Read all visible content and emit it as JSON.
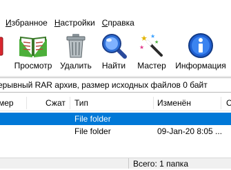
{
  "menu": {
    "favorites": "Избранное",
    "favorites_hotkey": "И",
    "settings": "Настройки",
    "settings_hotkey": "Н",
    "help": "Справка",
    "help_hotkey": "С"
  },
  "toolbar": {
    "view": "Просмотр",
    "delete": "Удалить",
    "find": "Найти",
    "wizard": "Мастер",
    "info": "Информация"
  },
  "infobar": {
    "text": "ерывный RAR архив, размер исходных файлов 0 байт"
  },
  "columns": {
    "size": "мер",
    "packed": "Сжат",
    "type": "Тип",
    "modified": "Изменён",
    "crc": "C"
  },
  "rows": [
    {
      "type": "File folder",
      "modified": ""
    },
    {
      "type": "File folder",
      "modified": "09-Jan-20 8:05 ..."
    }
  ],
  "status": {
    "total": "Всего: 1 папка"
  },
  "colors": {
    "selection": "#0078d7"
  }
}
